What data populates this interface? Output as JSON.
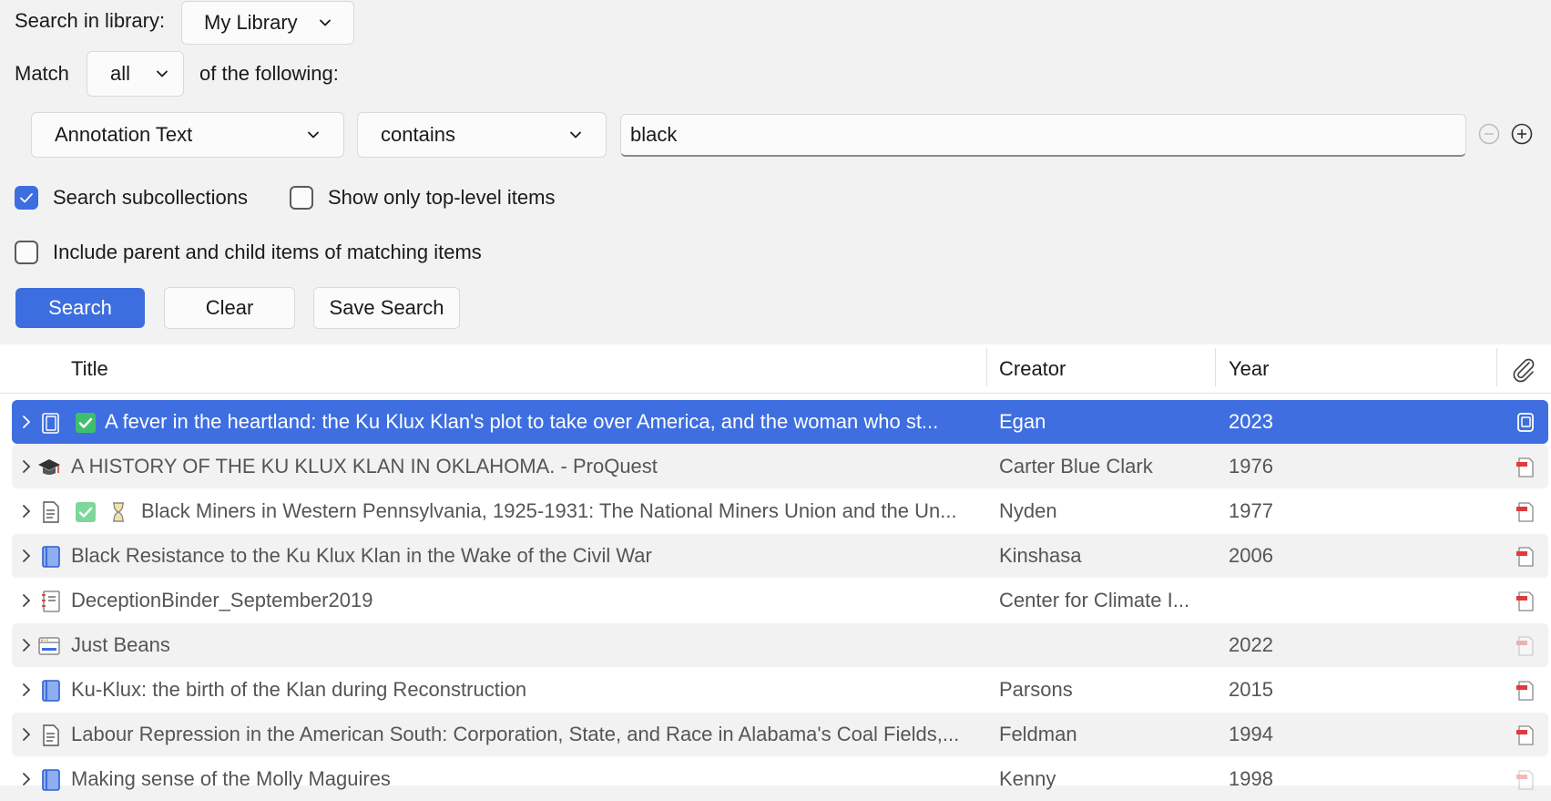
{
  "search": {
    "library_label": "Search in library:",
    "library_value": "My Library",
    "match_label": "Match",
    "match_value": "all",
    "match_suffix": "of the following:",
    "condition": {
      "field": "Annotation Text",
      "operator": "contains",
      "value": "black"
    },
    "options": {
      "search_subcollections": {
        "label": "Search subcollections",
        "checked": true
      },
      "top_level_only": {
        "label": "Show only top-level items",
        "checked": false
      },
      "include_parent_child": {
        "label": "Include parent and child items of matching items",
        "checked": false
      }
    },
    "buttons": {
      "search": "Search",
      "clear": "Clear",
      "save": "Save Search"
    }
  },
  "table": {
    "columns": {
      "title": "Title",
      "creator": "Creator",
      "year": "Year"
    },
    "rows": [
      {
        "type_icon": "book-section-icon",
        "tag": "green-check",
        "title": "A fever in the heartland: the Ku Klux Klan's plot to take over America, and the woman who st...",
        "creator": "Egan",
        "year": "2023",
        "attachment": "snapshot-icon",
        "selected": true
      },
      {
        "type_icon": "thesis-icon",
        "title": "A HISTORY OF THE KU KLUX KLAN IN OKLAHOMA. - ProQuest",
        "creator": "Carter Blue Clark",
        "year": "1976",
        "attachment": "pdf-icon"
      },
      {
        "type_icon": "journal-article-icon",
        "tag": "green-check",
        "tag2": "hourglass",
        "title": "Black Miners in Western Pennsylvania, 1925-1931: The National Miners Union and the Un...",
        "creator": "Nyden",
        "year": "1977",
        "attachment": "pdf-icon"
      },
      {
        "type_icon": "book-icon",
        "title": "Black Resistance to the Ku Klux Klan in the Wake of the Civil War",
        "creator": "Kinshasa",
        "year": "2006",
        "attachment": "pdf-icon"
      },
      {
        "type_icon": "report-icon",
        "title": "DeceptionBinder_September2019",
        "creator": "Center for Climate I...",
        "year": "",
        "attachment": "pdf-icon"
      },
      {
        "type_icon": "webpage-icon",
        "title": "Just Beans",
        "creator": "",
        "year": "2022",
        "attachment": "pdf-faded-icon"
      },
      {
        "type_icon": "book-icon",
        "title": "Ku-Klux: the birth of the Klan during Reconstruction",
        "creator": "Parsons",
        "year": "2015",
        "attachment": "pdf-icon"
      },
      {
        "type_icon": "journal-article-icon",
        "title": "Labour Repression in the American South: Corporation, State, and Race in Alabama's Coal Fields,...",
        "creator": "Feldman",
        "year": "1994",
        "attachment": "pdf-icon"
      },
      {
        "type_icon": "book-icon",
        "title": "Making sense of the Molly Maguires",
        "creator": "Kenny",
        "year": "1998",
        "attachment": "pdf-faded-icon"
      }
    ]
  }
}
